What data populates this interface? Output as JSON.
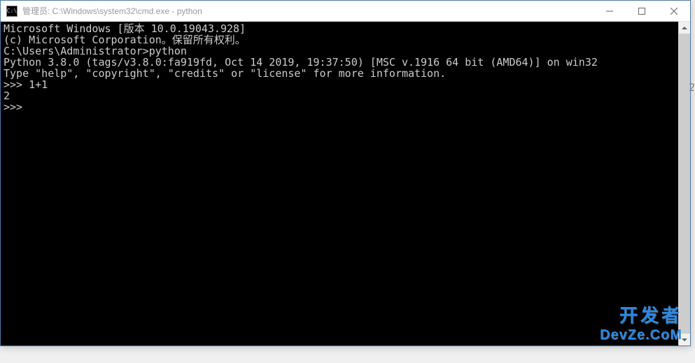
{
  "window": {
    "title": "管理员: C:\\Windows\\system32\\cmd.exe - python",
    "icon_label": "C:\\"
  },
  "console": {
    "lines": [
      "Microsoft Windows [版本 10.0.19043.928]",
      "(c) Microsoft Corporation。保留所有权利。",
      "",
      "C:\\Users\\Administrator>python",
      "Python 3.8.0 (tags/v3.8.0:fa919fd, Oct 14 2019, 19:37:50) [MSC v.1916 64 bit (AMD64)] on win32",
      "Type \"help\", \"copyright\", \"credits\" or \"license\" for more information.",
      ">>> 1+1",
      "2",
      ">>>"
    ]
  },
  "watermark": {
    "line1": "开发者",
    "line2": "DevZe.CoM"
  },
  "edge_char": "2"
}
